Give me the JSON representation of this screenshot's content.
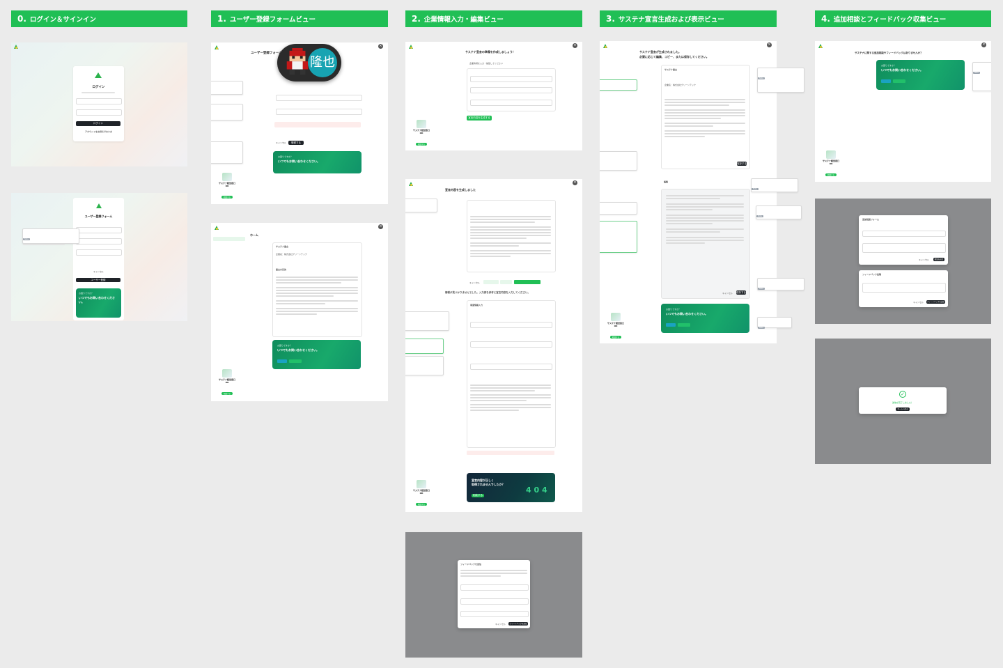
{
  "columns": [
    {
      "num": "0.",
      "title": "ログイン＆サインイン"
    },
    {
      "num": "1.",
      "title": "ユーザー登録フォームビュー"
    },
    {
      "num": "2.",
      "title": "企業情報入力・編集ビュー"
    },
    {
      "num": "3.",
      "title": "サステナ宣言生成および表示ビュー"
    },
    {
      "num": "4.",
      "title": "追加相談とフィードバック収集ビュー"
    }
  ],
  "login": {
    "title": "ログイン",
    "button": "ログイン",
    "link": "アカウントをお持ちでない方"
  },
  "signup": {
    "title": "ユーザー登録フォーム",
    "button": "ユーザー登録",
    "cancel": "キャンセル"
  },
  "banner": {
    "title": "お困りですか？",
    "headline": "いつでもお問い合わせください。",
    "sub": "サステナビリティに関するご相談はこちら",
    "btn1": "チャット",
    "btn2": "お問い合わせ"
  },
  "widget": {
    "title": "サステナ経営窓口OK",
    "button": "相談する"
  },
  "avatar": {
    "text": "隆也"
  },
  "form1": {
    "heading": "ユーザー登録フォーム",
    "submit": "登録する",
    "cancel": "キャンセル"
  },
  "home": {
    "heading": "ホーム",
    "section": "サステナ宣言",
    "company": "企業名：株式会社グリーンテック",
    "subsection": "宣言の目的"
  },
  "company": {
    "heading": "サステナ宣言の準備を作成しましょう！",
    "sub": "企業情報を入力・編集してください",
    "submit": "宣言内容を生成する"
  },
  "generated": {
    "heading": "宣言内容を生成しました",
    "notfound": "情報が見つかりませんでした。入力例を参考に宣言内容を入力してください。",
    "section": "事業情報入力",
    "cancel": "キャンセル",
    "btn_a": "企業情報を編集する",
    "btn_b": "再生成する",
    "btn_c": "サステナ宣言を作成する"
  },
  "promo": {
    "line1": "宣言内容が正しく",
    "line2": "取得されませんでしたか？",
    "big": "4 0 4",
    "btn": "相談する"
  },
  "feedback_modal": {
    "title": "フィードバックを送信",
    "cancel": "キャンセル",
    "submit": "フィードバックを送信"
  },
  "declaration": {
    "heading1": "サステナ宣言が生成されました。",
    "heading2": "必要に応じて編集、コピー、または保存してください。",
    "section": "サステナ宣言",
    "company": "企業名：株式会社グリーンテック",
    "save": "保存する",
    "edit_heading": "編集",
    "cancel": "キャンセル"
  },
  "consult": {
    "heading": "サステナに関する追加相談やフィードバックはありませんか？"
  },
  "form_consult": {
    "title": "追加相談フォーム",
    "cancel": "キャンセル",
    "submit": "相談を送信"
  },
  "form_feedback": {
    "title": "フィードバック投稿",
    "cancel": "キャンセル",
    "submit": "フィードバックを送信"
  },
  "success": {
    "message": "送信が完了しました！",
    "button": "ホームへ戻る"
  }
}
